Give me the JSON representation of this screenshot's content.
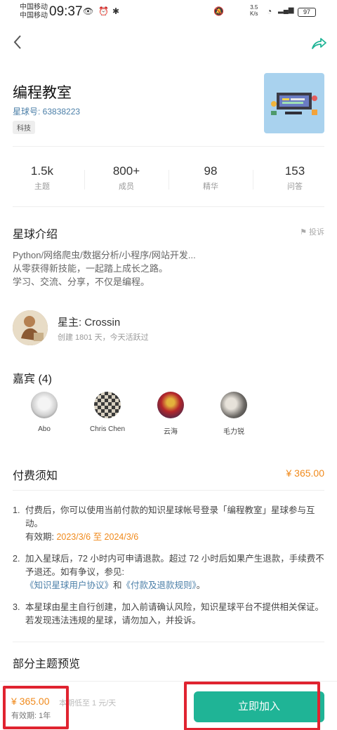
{
  "status_bar": {
    "carrier1": "中国移动",
    "carrier2": "中国移动",
    "time": "09:37",
    "net_speed_top": "3.5",
    "net_speed_bottom": "K/s",
    "battery": "97"
  },
  "group": {
    "name": "编程教室",
    "number": "星球号: 63838223",
    "tag": "科技"
  },
  "stats": [
    {
      "value": "1.5k",
      "label": "主题"
    },
    {
      "value": "800+",
      "label": "成员"
    },
    {
      "value": "98",
      "label": "精华"
    },
    {
      "value": "153",
      "label": "问答"
    }
  ],
  "intro": {
    "title": "星球介绍",
    "report": "投诉",
    "lines": [
      "Python/网络爬虫/数据分析/小程序/网站开发...",
      "从零获得新技能，一起踏上成长之路。",
      "学习、交流、分享，不仅是编程。"
    ]
  },
  "owner": {
    "name": "星主: Crossin",
    "meta": "创建 1801 天，今天活跃过"
  },
  "guests": {
    "title": "嘉宾 (4)",
    "list": [
      {
        "name": "Abo"
      },
      {
        "name": "Chris Chen"
      },
      {
        "name": "云海"
      },
      {
        "name": "毛力锐"
      }
    ]
  },
  "payment": {
    "title": "付费须知",
    "price": "¥ 365.00",
    "items": [
      {
        "num": "1.",
        "text": "付费后，你可以使用当前付款的知识星球帐号登录「编程教室」星球参与互动。",
        "valid_label": "有效期: ",
        "valid_range": "2023/3/6 至 2024/3/6"
      },
      {
        "num": "2.",
        "text": "加入星球后，72 小时内可申请退款。超过 72 小时后如果产生退款，手续费不予退还。如有争议，参见:",
        "link1": "《知识星球用户协议》",
        "and": "和",
        "link2": "《付款及退款规则》",
        "end": "。"
      },
      {
        "num": "3.",
        "text": "本星球由星主自行创建，加入前请确认风险，知识星球平台不提供相关保证。若发现违法违规的星球，请勿加入，并投诉。"
      }
    ]
  },
  "preview_title": "部分主题预览",
  "bottom": {
    "price": "¥ 365.00",
    "low": "本期低至 1 元/天",
    "valid": "有效期: 1年",
    "join": "立即加入"
  },
  "colors": {
    "accent": "#1fb496",
    "price": "#f08a1c",
    "link": "#4b7fa8",
    "highlight": "#e02330"
  }
}
